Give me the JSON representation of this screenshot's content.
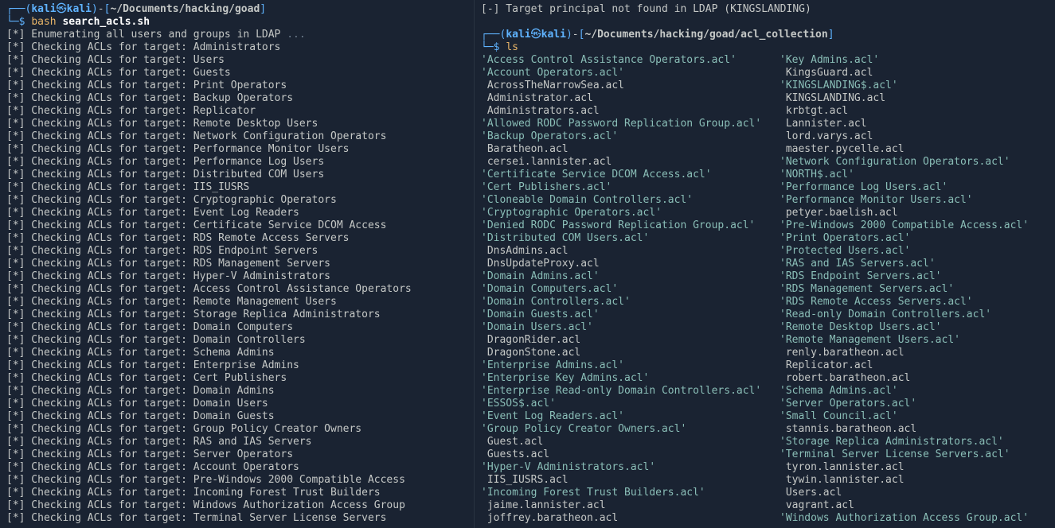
{
  "left": {
    "prompt": {
      "user": "kali",
      "at": "㉿",
      "host": "kali",
      "path": "~/Documents/hacking/goad"
    },
    "cmd_prefix": "bash",
    "cmd_arg": "search_acls.sh",
    "enum_line": "[*] Enumerating all users and groups in LDAP ",
    "enum_dots": "...",
    "check_prefix": "[*] Checking ACLs for target: ",
    "targets": [
      "Administrators",
      "Users",
      "Guests",
      "Print Operators",
      "Backup Operators",
      "Replicator",
      "Remote Desktop Users",
      "Network Configuration Operators",
      "Performance Monitor Users",
      "Performance Log Users",
      "Distributed COM Users",
      "IIS_IUSRS",
      "Cryptographic Operators",
      "Event Log Readers",
      "Certificate Service DCOM Access",
      "RDS Remote Access Servers",
      "RDS Endpoint Servers",
      "RDS Management Servers",
      "Hyper-V Administrators",
      "Access Control Assistance Operators",
      "Remote Management Users",
      "Storage Replica Administrators",
      "Domain Computers",
      "Domain Controllers",
      "Schema Admins",
      "Enterprise Admins",
      "Cert Publishers",
      "Domain Admins",
      "Domain Users",
      "Domain Guests",
      "Group Policy Creator Owners",
      "RAS and IAS Servers",
      "Server Operators",
      "Account Operators",
      "Pre-Windows 2000 Compatible Access",
      "Incoming Forest Trust Builders",
      "Windows Authorization Access Group",
      "Terminal Server License Servers"
    ]
  },
  "right": {
    "top_msg": "[-] Target principal not found in LDAP (KINGSLANDING)",
    "prompt": {
      "user": "kali",
      "at": "㉿",
      "host": "kali",
      "path": "~/Documents/hacking/goad/acl_collection"
    },
    "cmd": "ls",
    "files": [
      [
        "'Access Control Assistance Operators.acl'",
        "'Key Admins.acl'",
        true,
        true
      ],
      [
        "'Account Operators.acl'",
        " KingsGuard.acl",
        true,
        false
      ],
      [
        " AcrossTheNarrowSea.acl",
        "'KINGSLANDING$.acl'",
        false,
        true
      ],
      [
        " Administrator.acl",
        " KINGSLANDING.acl",
        false,
        false
      ],
      [
        " Administrators.acl",
        " krbtgt.acl",
        false,
        false
      ],
      [
        "'Allowed RODC Password Replication Group.acl'",
        " Lannister.acl",
        true,
        false
      ],
      [
        "'Backup Operators.acl'",
        " lord.varys.acl",
        true,
        false
      ],
      [
        " Baratheon.acl",
        " maester.pycelle.acl",
        false,
        false
      ],
      [
        " cersei.lannister.acl",
        "'Network Configuration Operators.acl'",
        false,
        true
      ],
      [
        "'Certificate Service DCOM Access.acl'",
        "'NORTH$.acl'",
        true,
        true
      ],
      [
        "'Cert Publishers.acl'",
        "'Performance Log Users.acl'",
        true,
        true
      ],
      [
        "'Cloneable Domain Controllers.acl'",
        "'Performance Monitor Users.acl'",
        true,
        true
      ],
      [
        "'Cryptographic Operators.acl'",
        " petyer.baelish.acl",
        true,
        false
      ],
      [
        "'Denied RODC Password Replication Group.acl'",
        "'Pre-Windows 2000 Compatible Access.acl'",
        true,
        true
      ],
      [
        "'Distributed COM Users.acl'",
        "'Print Operators.acl'",
        true,
        true
      ],
      [
        " DnsAdmins.acl",
        "'Protected Users.acl'",
        false,
        true
      ],
      [
        " DnsUpdateProxy.acl",
        "'RAS and IAS Servers.acl'",
        false,
        true
      ],
      [
        "'Domain Admins.acl'",
        "'RDS Endpoint Servers.acl'",
        true,
        true
      ],
      [
        "'Domain Computers.acl'",
        "'RDS Management Servers.acl'",
        true,
        true
      ],
      [
        "'Domain Controllers.acl'",
        "'RDS Remote Access Servers.acl'",
        true,
        true
      ],
      [
        "'Domain Guests.acl'",
        "'Read-only Domain Controllers.acl'",
        true,
        true
      ],
      [
        "'Domain Users.acl'",
        "'Remote Desktop Users.acl'",
        true,
        true
      ],
      [
        " DragonRider.acl",
        "'Remote Management Users.acl'",
        false,
        true
      ],
      [
        " DragonStone.acl",
        " renly.baratheon.acl",
        false,
        false
      ],
      [
        "'Enterprise Admins.acl'",
        " Replicator.acl",
        true,
        false
      ],
      [
        "'Enterprise Key Admins.acl'",
        " robert.baratheon.acl",
        true,
        false
      ],
      [
        "'Enterprise Read-only Domain Controllers.acl'",
        "'Schema Admins.acl'",
        true,
        true
      ],
      [
        "'ESSOS$.acl'",
        "'Server Operators.acl'",
        true,
        true
      ],
      [
        "'Event Log Readers.acl'",
        "'Small Council.acl'",
        true,
        true
      ],
      [
        "'Group Policy Creator Owners.acl'",
        " stannis.baratheon.acl",
        true,
        false
      ],
      [
        " Guest.acl",
        "'Storage Replica Administrators.acl'",
        false,
        true
      ],
      [
        " Guests.acl",
        "'Terminal Server License Servers.acl'",
        false,
        true
      ],
      [
        "'Hyper-V Administrators.acl'",
        " tyron.lannister.acl",
        true,
        false
      ],
      [
        " IIS_IUSRS.acl",
        " tywin.lannister.acl",
        false,
        false
      ],
      [
        "'Incoming Forest Trust Builders.acl'",
        " Users.acl",
        true,
        false
      ],
      [
        " jaime.lannister.acl",
        " vagrant.acl",
        false,
        false
      ],
      [
        " joffrey.baratheon.acl",
        "'Windows Authorization Access Group.acl'",
        false,
        true
      ]
    ]
  }
}
